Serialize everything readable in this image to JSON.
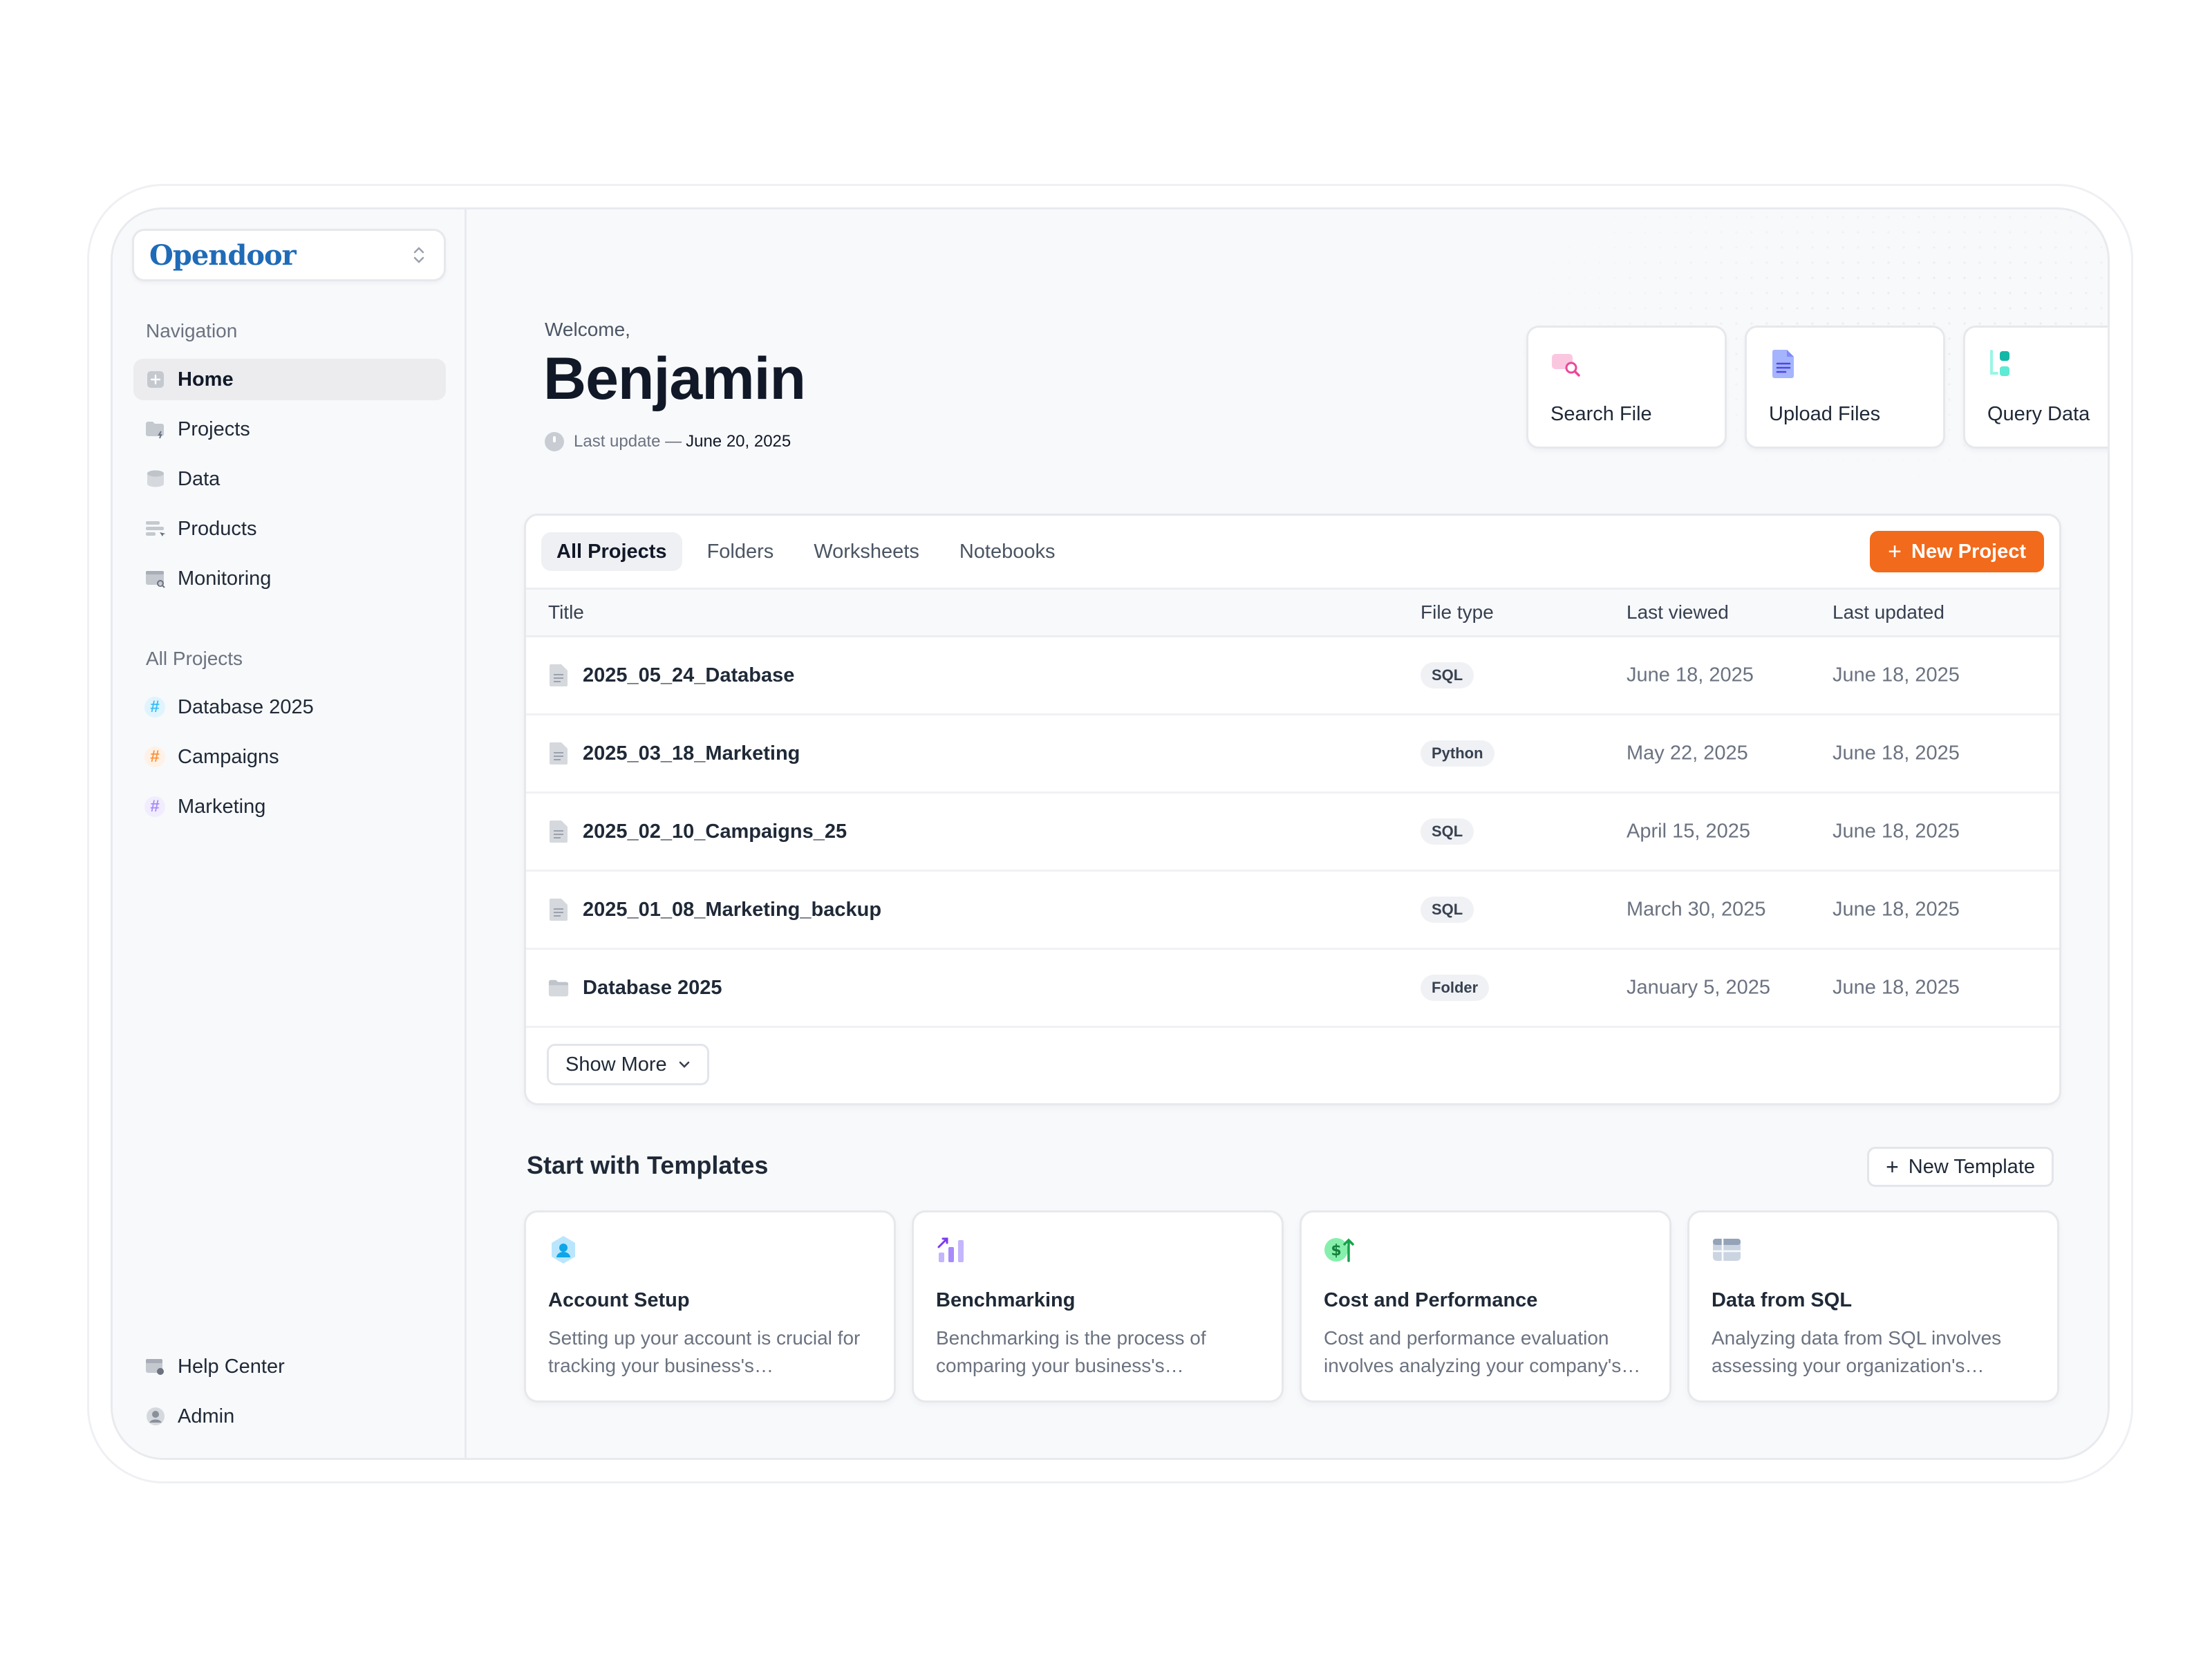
{
  "workspace": {
    "name": "Opendoor"
  },
  "sidebar": {
    "navigation_label": "Navigation",
    "nav": [
      {
        "label": "Home",
        "icon": "home-icon",
        "active": true
      },
      {
        "label": "Projects",
        "icon": "folder-icon"
      },
      {
        "label": "Data",
        "icon": "database-icon"
      },
      {
        "label": "Products",
        "icon": "products-icon"
      },
      {
        "label": "Monitoring",
        "icon": "monitoring-icon"
      }
    ],
    "projects_label": "All Projects",
    "projects": [
      {
        "label": "Database 2025",
        "color": "#38bdf8"
      },
      {
        "label": "Campaigns",
        "color": "#fb923c"
      },
      {
        "label": "Marketing",
        "color": "#a78bfa"
      }
    ],
    "footer": [
      {
        "label": "Help Center",
        "icon": "help-center-icon"
      },
      {
        "label": "Admin",
        "icon": "user-avatar-icon"
      }
    ]
  },
  "header": {
    "welcome": "Welcome,",
    "user": "Benjamin",
    "last_update_label": "Last update —",
    "last_update_date": "June 20, 2025"
  },
  "quick_actions": [
    {
      "label": "Search File",
      "icon": "search-file-icon",
      "color": "#f472b6"
    },
    {
      "label": "Upload Files",
      "icon": "upload-file-icon",
      "color": "#818cf8"
    },
    {
      "label": "Query Data",
      "icon": "query-data-icon",
      "color": "#2dd4bf"
    }
  ],
  "projects_panel": {
    "tabs": [
      "All Projects",
      "Folders",
      "Worksheets",
      "Notebooks"
    ],
    "active_tab": "All Projects",
    "new_project": "New Project",
    "columns": [
      "Title",
      "File type",
      "Last viewed",
      "Last updated"
    ],
    "rows": [
      {
        "title": "2025_05_24_Database",
        "type": "SQL",
        "viewed": "June 18, 2025",
        "updated": "June 18, 2025",
        "kind": "file"
      },
      {
        "title": "2025_03_18_Marketing",
        "type": "Python",
        "viewed": "May 22, 2025",
        "updated": "June 18, 2025",
        "kind": "file"
      },
      {
        "title": "2025_02_10_Campaigns_25",
        "type": "SQL",
        "viewed": "April 15, 2025",
        "updated": "June 18, 2025",
        "kind": "file"
      },
      {
        "title": "2025_01_08_Marketing_backup",
        "type": "SQL",
        "viewed": "March 30, 2025",
        "updated": "June 18, 2025",
        "kind": "file"
      },
      {
        "title": "Database 2025",
        "type": "Folder",
        "viewed": "January 5, 2025",
        "updated": "June 18, 2025",
        "kind": "folder"
      }
    ],
    "show_more": "Show More"
  },
  "templates": {
    "title": "Start with Templates",
    "new_template": "New Template",
    "cards": [
      {
        "title": "Account Setup",
        "desc": "Setting up your account is crucial for tracking your business's performance.",
        "icon": "account-setup-icon"
      },
      {
        "title": "Benchmarking",
        "desc": "Benchmarking is the process of comparing your business's performance.",
        "icon": "benchmarking-icon"
      },
      {
        "title": "Cost and Performance",
        "desc": "Cost and performance evaluation involves analyzing your company's costs.",
        "icon": "cost-performance-icon"
      },
      {
        "title": "Data from SQL",
        "desc": "Analyzing data from SQL involves assessing your organization's metrics.",
        "icon": "sql-table-icon"
      }
    ]
  },
  "colors": {
    "accent": "#f26a1b",
    "brand": "#1f6bb8"
  }
}
